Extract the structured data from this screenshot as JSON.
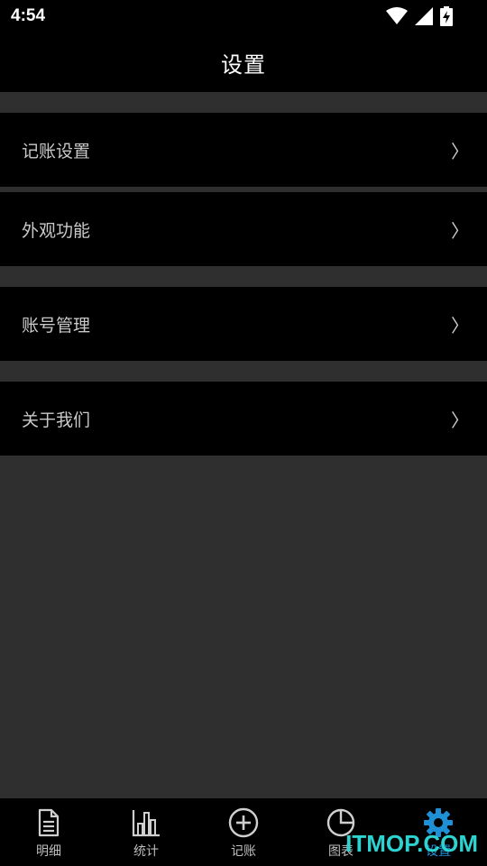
{
  "status_bar": {
    "time": "4:54",
    "icons": [
      "wifi-icon",
      "cell-signal-icon",
      "battery-charging-icon"
    ]
  },
  "app_bar": {
    "title": "设置"
  },
  "settings_items": [
    {
      "label": "记账设置",
      "chevron": "〉"
    },
    {
      "label": "外观功能",
      "chevron": "〉"
    },
    {
      "label": "账号管理",
      "chevron": "〉"
    },
    {
      "label": "关于我们",
      "chevron": "〉"
    }
  ],
  "bottom_nav": {
    "items": [
      {
        "label": "明细",
        "icon": "document-icon",
        "active": false
      },
      {
        "label": "统计",
        "icon": "bar-chart-icon",
        "active": false
      },
      {
        "label": "记账",
        "icon": "plus-circle-icon",
        "active": false
      },
      {
        "label": "图表",
        "icon": "pie-chart-icon",
        "active": false
      },
      {
        "label": "设置",
        "icon": "gear-icon",
        "active": true
      }
    ]
  },
  "colors": {
    "background": "#2f2f2f",
    "bar": "#000000",
    "accent": "#1f8fd6",
    "watermark": "#2dd3d0"
  },
  "watermark": "ITMOP.COM"
}
